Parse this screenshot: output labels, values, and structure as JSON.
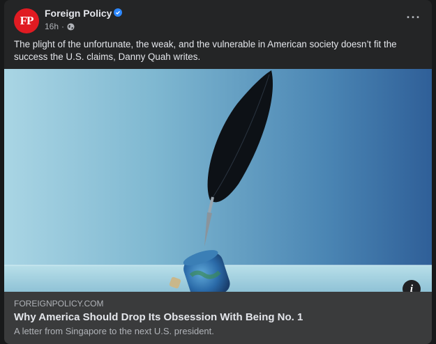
{
  "post": {
    "page_name": "Foreign Policy",
    "avatar_text": "FP",
    "time": "16h",
    "separator": "·",
    "more_label": "···",
    "text": "The plight of the unfortunate, the weak, and the vulnerable in American society doesn’t fit the success the U.S. claims, Danny Quah writes."
  },
  "link": {
    "domain": "FOREIGNPOLICY.COM",
    "title": "Why America Should Drop Its Obsession With Being No. 1",
    "description": "A letter from Singapore to the next U.S. president.",
    "info_label": "i"
  },
  "colors": {
    "background": "#18191a",
    "card": "#242526",
    "link_box": "#3a3b3c",
    "avatar": "#e01b22",
    "verified": "#2d88ff"
  },
  "icons": [
    "globe-icon",
    "verified-badge-icon",
    "more-options-icon",
    "info-icon"
  ]
}
